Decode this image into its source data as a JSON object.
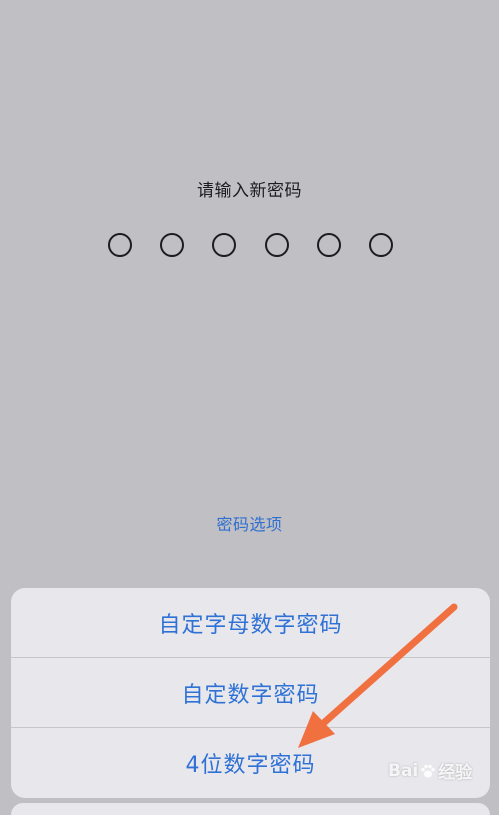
{
  "passcode": {
    "prompt": "请输入新密码",
    "digit_count": 6,
    "options_link": "密码选项"
  },
  "action_sheet": {
    "items": [
      {
        "label": "自定字母数字密码"
      },
      {
        "label": "自定数字密码"
      },
      {
        "label": "4位数字密码"
      }
    ]
  },
  "watermark": {
    "text_left": "Bai",
    "text_right": "经验"
  },
  "colors": {
    "accent": "#2f72d6",
    "arrow": "#f07040",
    "background": "#c0bfc4"
  }
}
